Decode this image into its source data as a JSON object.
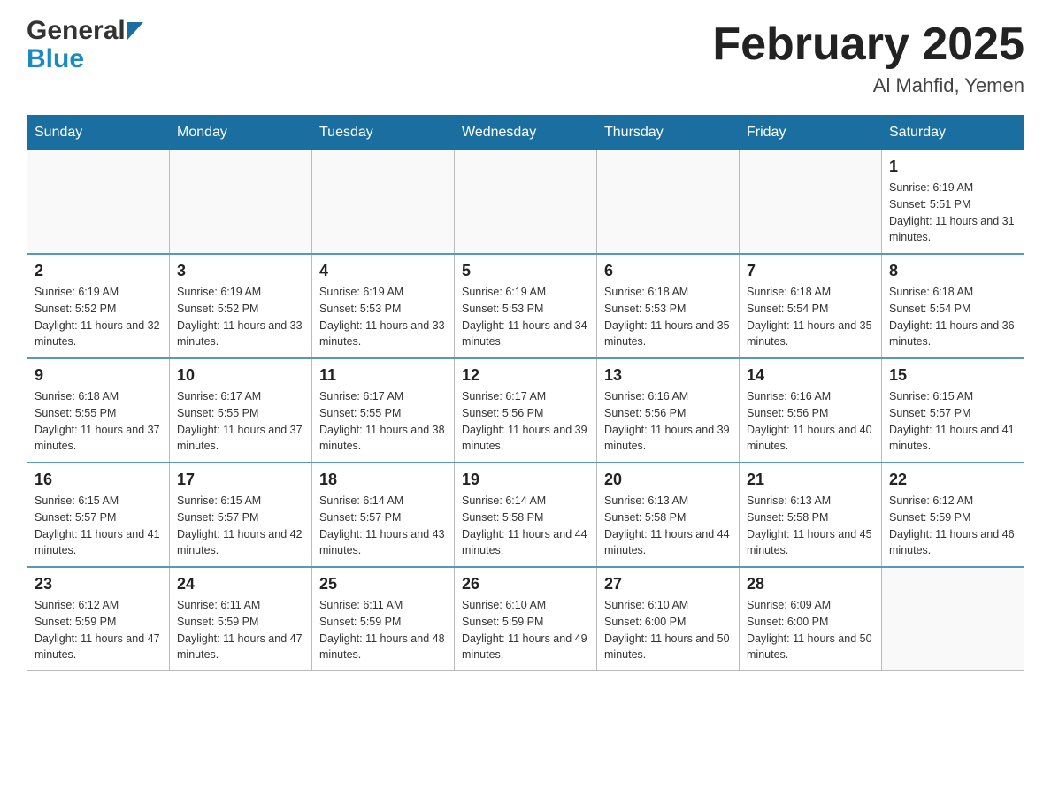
{
  "header": {
    "logo_general": "General",
    "logo_blue": "Blue",
    "title": "February 2025",
    "subtitle": "Al Mahfid, Yemen"
  },
  "calendar": {
    "days_of_week": [
      "Sunday",
      "Monday",
      "Tuesday",
      "Wednesday",
      "Thursday",
      "Friday",
      "Saturday"
    ],
    "weeks": [
      {
        "days": [
          {
            "number": "",
            "info": ""
          },
          {
            "number": "",
            "info": ""
          },
          {
            "number": "",
            "info": ""
          },
          {
            "number": "",
            "info": ""
          },
          {
            "number": "",
            "info": ""
          },
          {
            "number": "",
            "info": ""
          },
          {
            "number": "1",
            "info": "Sunrise: 6:19 AM\nSunset: 5:51 PM\nDaylight: 11 hours and 31 minutes."
          }
        ]
      },
      {
        "days": [
          {
            "number": "2",
            "info": "Sunrise: 6:19 AM\nSunset: 5:52 PM\nDaylight: 11 hours and 32 minutes."
          },
          {
            "number": "3",
            "info": "Sunrise: 6:19 AM\nSunset: 5:52 PM\nDaylight: 11 hours and 33 minutes."
          },
          {
            "number": "4",
            "info": "Sunrise: 6:19 AM\nSunset: 5:53 PM\nDaylight: 11 hours and 33 minutes."
          },
          {
            "number": "5",
            "info": "Sunrise: 6:19 AM\nSunset: 5:53 PM\nDaylight: 11 hours and 34 minutes."
          },
          {
            "number": "6",
            "info": "Sunrise: 6:18 AM\nSunset: 5:53 PM\nDaylight: 11 hours and 35 minutes."
          },
          {
            "number": "7",
            "info": "Sunrise: 6:18 AM\nSunset: 5:54 PM\nDaylight: 11 hours and 35 minutes."
          },
          {
            "number": "8",
            "info": "Sunrise: 6:18 AM\nSunset: 5:54 PM\nDaylight: 11 hours and 36 minutes."
          }
        ]
      },
      {
        "days": [
          {
            "number": "9",
            "info": "Sunrise: 6:18 AM\nSunset: 5:55 PM\nDaylight: 11 hours and 37 minutes."
          },
          {
            "number": "10",
            "info": "Sunrise: 6:17 AM\nSunset: 5:55 PM\nDaylight: 11 hours and 37 minutes."
          },
          {
            "number": "11",
            "info": "Sunrise: 6:17 AM\nSunset: 5:55 PM\nDaylight: 11 hours and 38 minutes."
          },
          {
            "number": "12",
            "info": "Sunrise: 6:17 AM\nSunset: 5:56 PM\nDaylight: 11 hours and 39 minutes."
          },
          {
            "number": "13",
            "info": "Sunrise: 6:16 AM\nSunset: 5:56 PM\nDaylight: 11 hours and 39 minutes."
          },
          {
            "number": "14",
            "info": "Sunrise: 6:16 AM\nSunset: 5:56 PM\nDaylight: 11 hours and 40 minutes."
          },
          {
            "number": "15",
            "info": "Sunrise: 6:15 AM\nSunset: 5:57 PM\nDaylight: 11 hours and 41 minutes."
          }
        ]
      },
      {
        "days": [
          {
            "number": "16",
            "info": "Sunrise: 6:15 AM\nSunset: 5:57 PM\nDaylight: 11 hours and 41 minutes."
          },
          {
            "number": "17",
            "info": "Sunrise: 6:15 AM\nSunset: 5:57 PM\nDaylight: 11 hours and 42 minutes."
          },
          {
            "number": "18",
            "info": "Sunrise: 6:14 AM\nSunset: 5:57 PM\nDaylight: 11 hours and 43 minutes."
          },
          {
            "number": "19",
            "info": "Sunrise: 6:14 AM\nSunset: 5:58 PM\nDaylight: 11 hours and 44 minutes."
          },
          {
            "number": "20",
            "info": "Sunrise: 6:13 AM\nSunset: 5:58 PM\nDaylight: 11 hours and 44 minutes."
          },
          {
            "number": "21",
            "info": "Sunrise: 6:13 AM\nSunset: 5:58 PM\nDaylight: 11 hours and 45 minutes."
          },
          {
            "number": "22",
            "info": "Sunrise: 6:12 AM\nSunset: 5:59 PM\nDaylight: 11 hours and 46 minutes."
          }
        ]
      },
      {
        "days": [
          {
            "number": "23",
            "info": "Sunrise: 6:12 AM\nSunset: 5:59 PM\nDaylight: 11 hours and 47 minutes."
          },
          {
            "number": "24",
            "info": "Sunrise: 6:11 AM\nSunset: 5:59 PM\nDaylight: 11 hours and 47 minutes."
          },
          {
            "number": "25",
            "info": "Sunrise: 6:11 AM\nSunset: 5:59 PM\nDaylight: 11 hours and 48 minutes."
          },
          {
            "number": "26",
            "info": "Sunrise: 6:10 AM\nSunset: 5:59 PM\nDaylight: 11 hours and 49 minutes."
          },
          {
            "number": "27",
            "info": "Sunrise: 6:10 AM\nSunset: 6:00 PM\nDaylight: 11 hours and 50 minutes."
          },
          {
            "number": "28",
            "info": "Sunrise: 6:09 AM\nSunset: 6:00 PM\nDaylight: 11 hours and 50 minutes."
          },
          {
            "number": "",
            "info": ""
          }
        ]
      }
    ]
  }
}
